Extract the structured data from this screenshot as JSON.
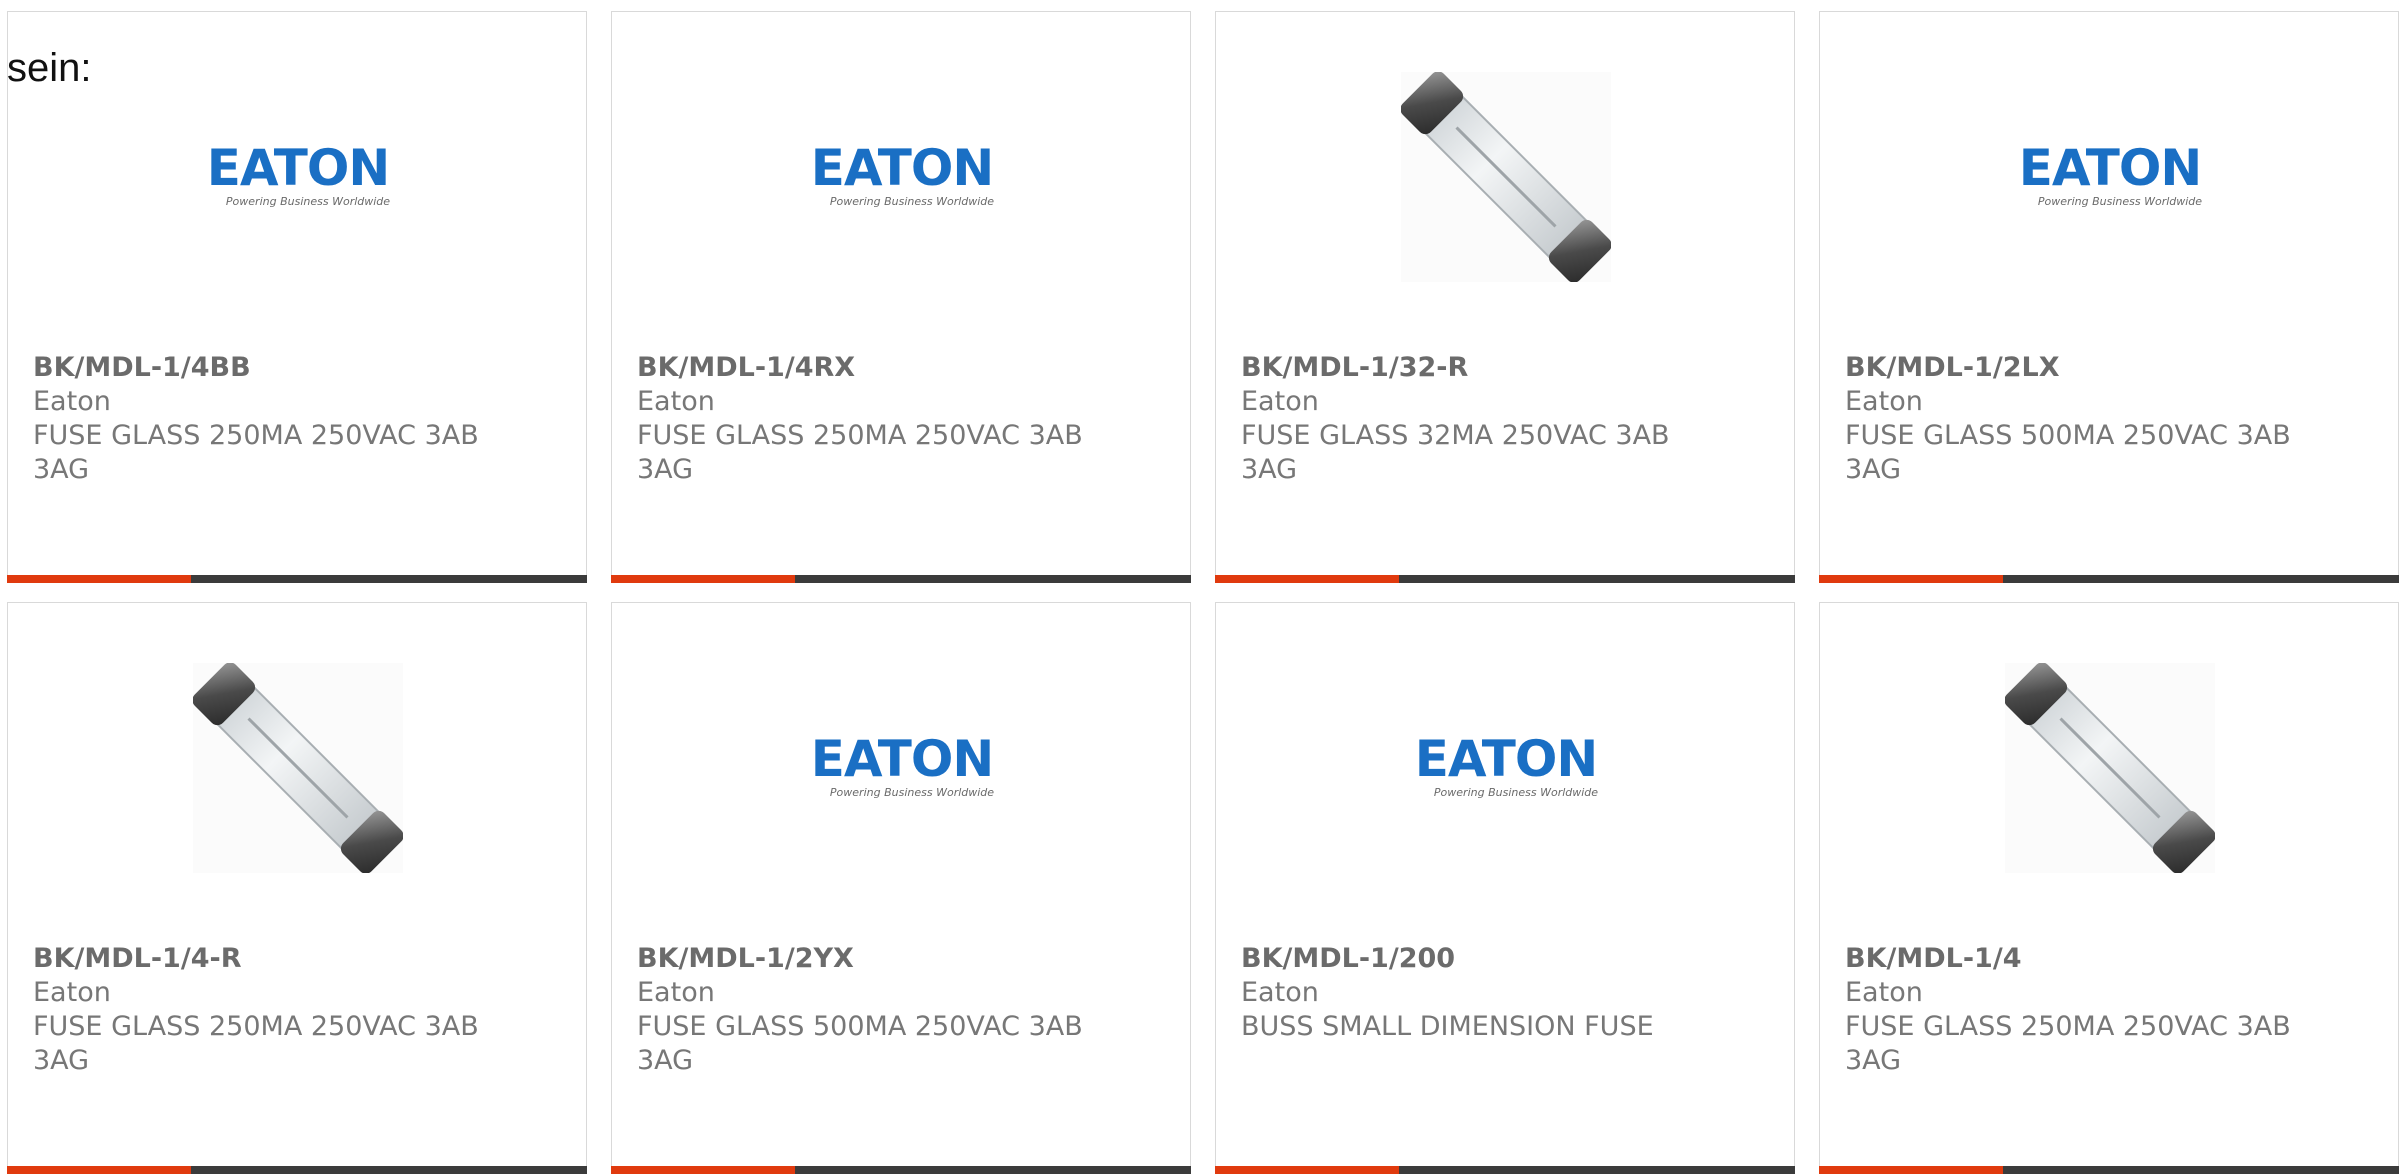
{
  "intro_text": "sein:",
  "colors": {
    "accent": "#e03a0e",
    "bar_dark": "#3b3b3b",
    "eaton_blue": "#1a6fc4"
  },
  "eaton_tagline": "Powering Business Worldwide",
  "eaton_wordmark": "EATON",
  "products": [
    {
      "part": "BK/MDL-1/4BB",
      "brand": "Eaton",
      "description": "FUSE GLASS 250MA 250VAC 3AB\n3AG",
      "image": "eaton-logo"
    },
    {
      "part": "BK/MDL-1/4RX",
      "brand": "Eaton",
      "description": "FUSE GLASS 250MA 250VAC 3AB\n3AG",
      "image": "eaton-logo"
    },
    {
      "part": "BK/MDL-1/32-R",
      "brand": "Eaton",
      "description": "FUSE GLASS 32MA 250VAC 3AB\n3AG",
      "image": "glass-fuse"
    },
    {
      "part": "BK/MDL-1/2LX",
      "brand": "Eaton",
      "description": "FUSE GLASS 500MA 250VAC 3AB\n3AG",
      "image": "eaton-logo"
    },
    {
      "part": "BK/MDL-1/4-R",
      "brand": "Eaton",
      "description": "FUSE GLASS 250MA 250VAC 3AB\n3AG",
      "image": "glass-fuse"
    },
    {
      "part": "BK/MDL-1/2YX",
      "brand": "Eaton",
      "description": "FUSE GLASS 500MA 250VAC 3AB\n3AG",
      "image": "eaton-logo"
    },
    {
      "part": "BK/MDL-1/200",
      "brand": "Eaton",
      "description": "BUSS SMALL DIMENSION FUSE",
      "image": "eaton-logo"
    },
    {
      "part": "BK/MDL-1/4",
      "brand": "Eaton",
      "description": "FUSE GLASS 250MA 250VAC 3AB\n3AG",
      "image": "glass-fuse"
    }
  ]
}
